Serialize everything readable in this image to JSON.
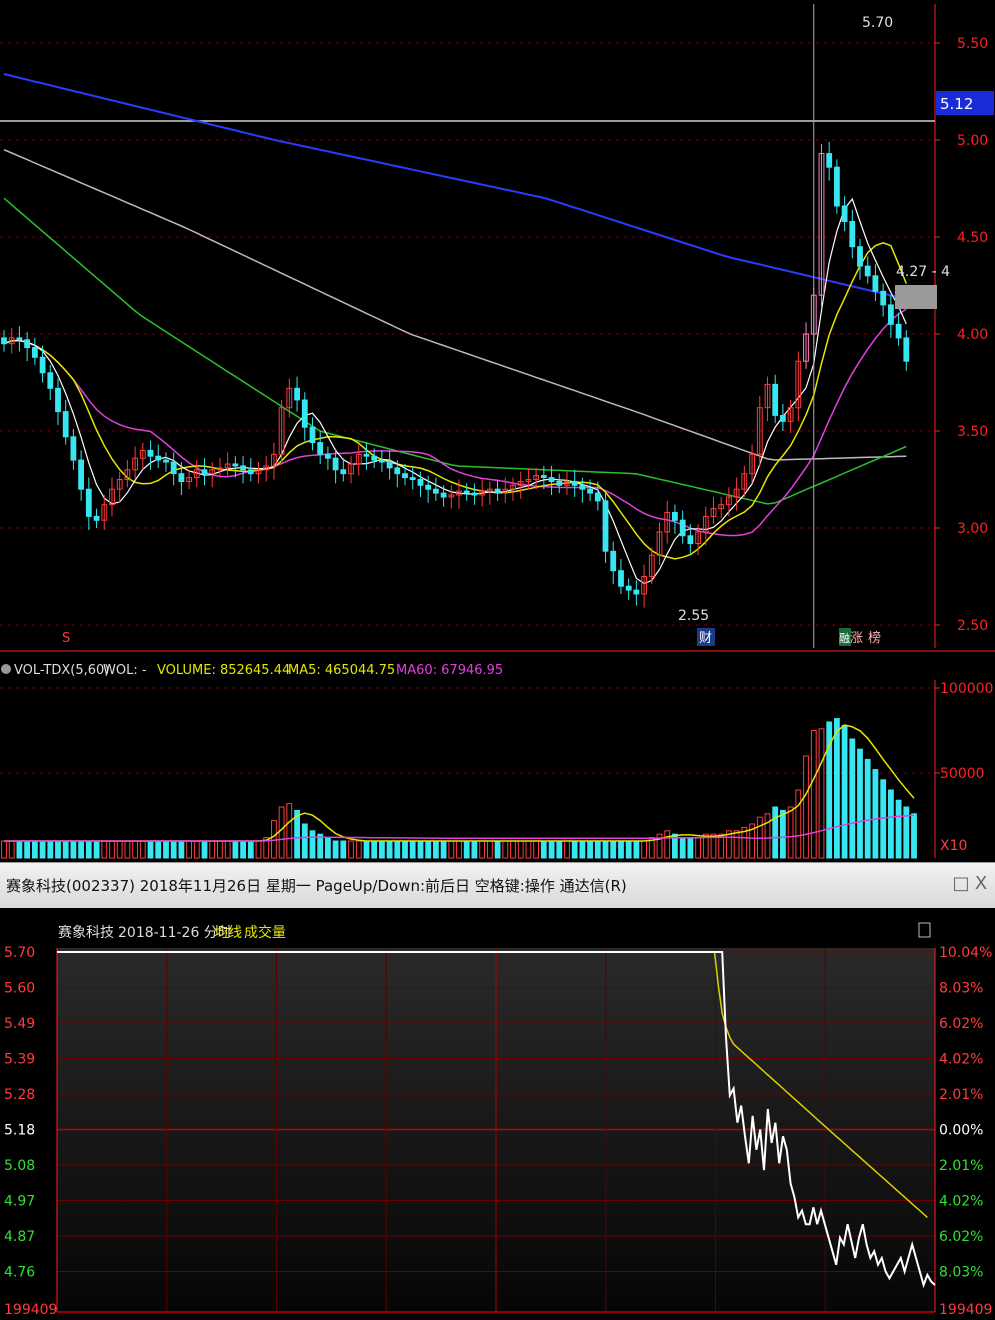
{
  "colors": {
    "up": "#ff3b3b",
    "down": "#37e6f0",
    "ma5": "#ffffff",
    "ma10": "#e6e600",
    "ma20": "#e040e0",
    "ma60": "#2cc02c",
    "ma120": "#bbbbbb",
    "ma250": "#2a3cff",
    "grid": "#7a0000",
    "axis": "#ff2020",
    "price_line": "#ffffff",
    "avg_line": "#e0d000",
    "highlight_up": "#ff7ec5",
    "highlight_down": "#2fd42f"
  },
  "kline": {
    "y_ticks": [
      "5.50",
      "5.00",
      "4.50",
      "4.00",
      "3.50",
      "3.00",
      "2.50"
    ],
    "price_tag": "5.12",
    "high_label": "5.70",
    "low_label": "2.55",
    "annotation": "4.27 - 4",
    "badges": {
      "s": "S",
      "cai": "财",
      "zhang": "涨",
      "bang": "榜",
      "fu": "融"
    },
    "candles": [
      3.95,
      3.98,
      3.97,
      3.93,
      3.88,
      3.8,
      3.72,
      3.6,
      3.47,
      3.35,
      3.2,
      3.06,
      3.04,
      3.12,
      3.2,
      3.25,
      3.3,
      3.36,
      3.4,
      3.37,
      3.35,
      3.34,
      3.28,
      3.24,
      3.26,
      3.3,
      3.28,
      3.3,
      3.31,
      3.33,
      3.32,
      3.3,
      3.28,
      3.3,
      3.32,
      3.38,
      3.62,
      3.72,
      3.66,
      3.52,
      3.44,
      3.38,
      3.36,
      3.3,
      3.28,
      3.33,
      3.38,
      3.37,
      3.35,
      3.34,
      3.31,
      3.28,
      3.26,
      3.25,
      3.22,
      3.2,
      3.18,
      3.16,
      3.17,
      3.19,
      3.18,
      3.17,
      3.19,
      3.2,
      3.18,
      3.2,
      3.22,
      3.24,
      3.25,
      3.27,
      3.26,
      3.24,
      3.22,
      3.24,
      3.22,
      3.2,
      3.18,
      3.14,
      2.88,
      2.78,
      2.7,
      2.68,
      2.66,
      2.75,
      2.86,
      2.98,
      3.08,
      3.04,
      2.96,
      2.92,
      2.98,
      3.06,
      3.1,
      3.12,
      3.16,
      3.2,
      3.28,
      3.38,
      3.62,
      3.74,
      3.58,
      3.55,
      3.62,
      3.86,
      4.0,
      4.2,
      4.93,
      4.86,
      4.66,
      4.58,
      4.45,
      4.35,
      4.3,
      4.22,
      4.15,
      4.05,
      3.98,
      3.86
    ]
  },
  "volume": {
    "legend": {
      "indicator": "VOL-TDX(5,60)",
      "wol": "WOL: -",
      "volume": "VOLUME: 852645.44",
      "ma5": "MA5: 465044.75",
      "ma60": "MA60: 67946.95"
    },
    "y_ticks": [
      "100000",
      "50000"
    ],
    "multiplier": "X10",
    "values": [
      10,
      10,
      10,
      10,
      10,
      10,
      10,
      10,
      10,
      10,
      10,
      10,
      10,
      10,
      10,
      10,
      10,
      10,
      10,
      10,
      10,
      10,
      10,
      10,
      10,
      10,
      10,
      10,
      10,
      10,
      10,
      10,
      10,
      10,
      12,
      22,
      30,
      32,
      28,
      20,
      16,
      14,
      12,
      10,
      10,
      10,
      10,
      10,
      10,
      10,
      10,
      10,
      10,
      10,
      10,
      10,
      10,
      10,
      10,
      10,
      10,
      10,
      10,
      10,
      10,
      10,
      10,
      10,
      10,
      10,
      10,
      10,
      10,
      10,
      10,
      10,
      10,
      10,
      10,
      10,
      10,
      10,
      10,
      10,
      12,
      14,
      16,
      14,
      12,
      12,
      12,
      14,
      14,
      14,
      16,
      16,
      18,
      20,
      24,
      26,
      30,
      28,
      30,
      40,
      60,
      75,
      76,
      80,
      82,
      78,
      70,
      64,
      58,
      52,
      46,
      40,
      34,
      30,
      26
    ]
  },
  "window": {
    "title": "赛象科技(002337) 2018年11月26日 星期一 PageUp/Down:前后日 空格键:操作 通达信(R)",
    "restore_glyph": "□",
    "close_glyph": "X"
  },
  "minute": {
    "header_name": "赛象科技",
    "header_date": "2018-11-26 分时",
    "legend_avg": "均线",
    "legend_vol": "成交量",
    "prev_close": 5.18,
    "y_ticks_left": [
      "5.70",
      "5.60",
      "5.49",
      "5.39",
      "5.28",
      "5.18",
      "5.08",
      "4.97",
      "4.87",
      "4.76"
    ],
    "y_ticks_right": [
      "10.04%",
      "8.03%",
      "6.02%",
      "4.02%",
      "2.01%",
      "0.00%",
      "2.01%",
      "4.02%",
      "6.02%",
      "8.03%"
    ],
    "bottom_left": "199409",
    "bottom_right": "199409",
    "price": [
      5.7,
      5.7,
      5.7,
      5.7,
      5.7,
      5.7,
      5.7,
      5.7,
      5.7,
      5.7,
      5.7,
      5.7,
      5.7,
      5.7,
      5.7,
      5.7,
      5.7,
      5.7,
      5.7,
      5.7,
      5.7,
      5.7,
      5.7,
      5.7,
      5.7,
      5.7,
      5.7,
      5.7,
      5.7,
      5.7,
      5.7,
      5.7,
      5.7,
      5.7,
      5.7,
      5.7,
      5.7,
      5.7,
      5.7,
      5.7,
      5.7,
      5.7,
      5.7,
      5.7,
      5.7,
      5.7,
      5.7,
      5.7,
      5.7,
      5.7,
      5.7,
      5.7,
      5.7,
      5.7,
      5.7,
      5.7,
      5.7,
      5.7,
      5.7,
      5.7,
      5.7,
      5.7,
      5.7,
      5.7,
      5.7,
      5.7,
      5.7,
      5.7,
      5.7,
      5.7,
      5.7,
      5.7,
      5.7,
      5.7,
      5.7,
      5.7,
      5.7,
      5.7,
      5.7,
      5.7,
      5.7,
      5.7,
      5.7,
      5.7,
      5.7,
      5.7,
      5.7,
      5.7,
      5.7,
      5.7,
      5.7,
      5.7,
      5.7,
      5.7,
      5.7,
      5.7,
      5.7,
      5.7,
      5.7,
      5.7,
      5.7,
      5.7,
      5.7,
      5.7,
      5.7,
      5.7,
      5.7,
      5.7,
      5.7,
      5.7,
      5.7,
      5.7,
      5.7,
      5.7,
      5.7,
      5.7,
      5.7,
      5.7,
      5.7,
      5.7,
      5.7,
      5.7,
      5.7,
      5.7,
      5.7,
      5.7,
      5.7,
      5.7,
      5.7,
      5.7,
      5.7,
      5.7,
      5.7,
      5.7,
      5.7,
      5.7,
      5.7,
      5.7,
      5.7,
      5.7,
      5.7,
      5.7,
      5.7,
      5.7,
      5.7,
      5.7,
      5.7,
      5.7,
      5.7,
      5.7,
      5.7,
      5.7,
      5.7,
      5.7,
      5.7,
      5.7,
      5.7,
      5.7,
      5.7,
      5.7,
      5.7,
      5.7,
      5.7,
      5.7,
      5.7,
      5.7,
      5.7,
      5.7,
      5.7,
      5.7,
      5.7,
      5.7,
      5.7,
      5.7,
      5.7,
      5.7,
      5.45,
      5.28,
      5.3,
      5.2,
      5.25,
      5.16,
      5.08,
      5.22,
      5.12,
      5.18,
      5.06,
      5.24,
      5.14,
      5.2,
      5.08,
      5.16,
      5.12,
      5.02,
      4.98,
      4.92,
      4.94,
      4.9,
      4.9,
      4.95,
      4.9,
      4.94,
      4.9,
      4.86,
      4.82,
      4.78,
      4.86,
      4.84,
      4.9,
      4.85,
      4.8,
      4.86,
      4.9,
      4.84,
      4.8,
      4.82,
      4.78,
      4.8,
      4.76,
      4.74,
      4.76,
      4.78,
      4.8,
      4.76,
      4.8,
      4.84,
      4.8,
      4.76,
      4.72,
      4.75,
      4.73,
      4.72
    ],
    "avg": [
      5.7,
      5.7,
      5.7,
      5.7,
      5.7,
      5.7,
      5.7,
      5.7,
      5.7,
      5.7,
      5.7,
      5.7,
      5.7,
      5.7,
      5.7,
      5.7,
      5.7,
      5.7,
      5.7,
      5.7,
      5.7,
      5.7,
      5.7,
      5.7,
      5.7,
      5.7,
      5.7,
      5.7,
      5.7,
      5.7,
      5.7,
      5.7,
      5.7,
      5.7,
      5.7,
      5.7,
      5.7,
      5.7,
      5.7,
      5.7,
      5.7,
      5.7,
      5.7,
      5.7,
      5.7,
      5.7,
      5.7,
      5.7,
      5.7,
      5.7,
      5.7,
      5.7,
      5.7,
      5.7,
      5.7,
      5.7,
      5.7,
      5.7,
      5.7,
      5.7,
      5.7,
      5.7,
      5.7,
      5.7,
      5.7,
      5.7,
      5.7,
      5.7,
      5.7,
      5.7,
      5.7,
      5.7,
      5.7,
      5.7,
      5.7,
      5.7,
      5.7,
      5.7,
      5.7,
      5.7,
      5.7,
      5.7,
      5.7,
      5.7,
      5.7,
      5.7,
      5.7,
      5.7,
      5.7,
      5.7,
      5.7,
      5.7,
      5.7,
      5.7,
      5.7,
      5.7,
      5.7,
      5.7,
      5.7,
      5.7,
      5.7,
      5.7,
      5.7,
      5.7,
      5.7,
      5.7,
      5.7,
      5.7,
      5.7,
      5.7,
      5.7,
      5.7,
      5.7,
      5.7,
      5.7,
      5.7,
      5.7,
      5.7,
      5.7,
      5.7,
      5.7,
      5.7,
      5.7,
      5.7,
      5.7,
      5.7,
      5.7,
      5.7,
      5.7,
      5.7,
      5.7,
      5.7,
      5.7,
      5.7,
      5.7,
      5.7,
      5.7,
      5.7,
      5.7,
      5.7,
      5.7,
      5.7,
      5.7,
      5.7,
      5.7,
      5.7,
      5.7,
      5.7,
      5.7,
      5.7,
      5.7,
      5.7,
      5.7,
      5.7,
      5.7,
      5.7,
      5.7,
      5.7,
      5.7,
      5.7,
      5.7,
      5.7,
      5.7,
      5.7,
      5.7,
      5.7,
      5.7,
      5.7,
      5.7,
      5.7,
      5.7,
      5.7,
      5.7,
      5.7,
      5.6,
      5.52,
      5.48,
      5.45,
      5.43,
      5.42,
      5.41,
      5.4,
      5.39,
      5.38,
      5.37,
      5.36,
      5.35,
      5.34,
      5.33,
      5.32,
      5.31,
      5.3,
      5.29,
      5.28,
      5.27,
      5.26,
      5.25,
      5.24,
      5.23,
      5.22,
      5.21,
      5.2,
      5.19,
      5.18,
      5.17,
      5.16,
      5.15,
      5.14,
      5.13,
      5.12,
      5.11,
      5.1,
      5.09,
      5.08,
      5.07,
      5.06,
      5.05,
      5.04,
      5.03,
      5.02,
      5.01,
      5.0,
      4.99,
      4.98,
      4.97,
      4.96,
      4.95,
      4.94,
      4.93,
      4.92
    ]
  }
}
